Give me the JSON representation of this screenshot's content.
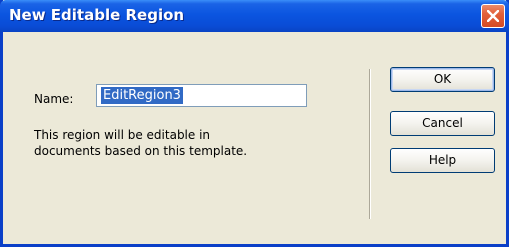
{
  "dialog": {
    "title": "New Editable Region",
    "close_icon": "close-icon",
    "name_label": "Name:",
    "name_value": "EditRegion3",
    "description_line1": "This region will be editable in",
    "description_line2": "documents based on this template.",
    "buttons": {
      "ok": "OK",
      "cancel": "Cancel",
      "help": "Help"
    }
  },
  "colors": {
    "title_bar": "#0b55e0",
    "dialog_bg": "#ece9d8",
    "close_button": "#e2603a",
    "selection": "#316ac5"
  }
}
